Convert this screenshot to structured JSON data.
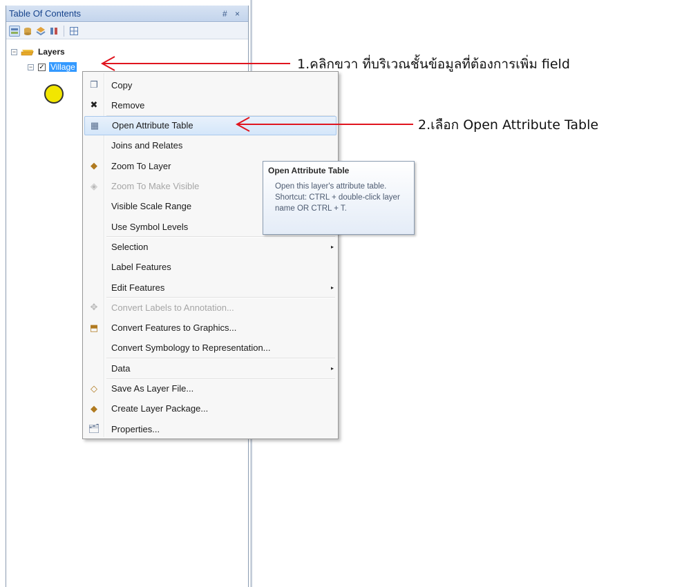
{
  "toc": {
    "title": "Table Of Contents",
    "title_controls": "# ×",
    "toolbar_icons": [
      "list-by-drawing-order-icon",
      "list-by-source-icon",
      "list-by-visibility-icon",
      "list-by-selection-icon",
      "options-icon"
    ],
    "tree": {
      "root_label": "Layers",
      "root_expander": "−",
      "layer_label": "Village",
      "layer_expander": "−",
      "layer_checked": "✓",
      "symbol_color": "#f2e600"
    }
  },
  "context_menu": {
    "items": [
      {
        "label": "Copy",
        "icon": "copy-icon",
        "glyph": "❐",
        "enabled": true
      },
      {
        "label": "Remove",
        "icon": "remove-icon",
        "glyph": "✖",
        "enabled": true
      },
      {
        "label": "Open Attribute Table",
        "icon": "table-icon",
        "glyph": "▦",
        "enabled": true,
        "highlighted": true
      },
      {
        "label": "Joins and Relates",
        "icon": "",
        "glyph": "",
        "enabled": true
      },
      {
        "label": "Zoom To Layer",
        "icon": "zoom-to-layer-icon",
        "glyph": "◆",
        "enabled": true
      },
      {
        "label": "Zoom To Make Visible",
        "icon": "zoom-to-make-visible-icon",
        "glyph": "◈",
        "enabled": false
      },
      {
        "label": "Visible Scale Range",
        "icon": "",
        "glyph": "",
        "enabled": true
      },
      {
        "label": "Use Symbol Levels",
        "icon": "",
        "glyph": "",
        "enabled": true
      },
      {
        "label": "Selection",
        "icon": "",
        "glyph": "",
        "enabled": true,
        "submenu": true
      },
      {
        "label": "Label Features",
        "icon": "",
        "glyph": "",
        "enabled": true
      },
      {
        "label": "Edit Features",
        "icon": "",
        "glyph": "",
        "enabled": true,
        "submenu": true
      },
      {
        "label": "Convert Labels to Annotation...",
        "icon": "convert-labels-icon",
        "glyph": "✥",
        "enabled": false
      },
      {
        "label": "Convert Features to Graphics...",
        "icon": "convert-features-icon",
        "glyph": "⬒",
        "enabled": true
      },
      {
        "label": "Convert Symbology to Representation...",
        "icon": "",
        "glyph": "",
        "enabled": true
      },
      {
        "label": "Data",
        "icon": "",
        "glyph": "",
        "enabled": true,
        "submenu": true
      },
      {
        "label": "Save As Layer File...",
        "icon": "save-layer-file-icon",
        "glyph": "◇",
        "enabled": true
      },
      {
        "label": "Create Layer Package...",
        "icon": "layer-package-icon",
        "glyph": "◆",
        "enabled": true
      },
      {
        "label": "Properties...",
        "icon": "properties-icon",
        "glyph": "🗂",
        "enabled": true
      }
    ],
    "submenu_arrow": "▸"
  },
  "tooltip": {
    "title": "Open Attribute Table",
    "body": "Open this layer's attribute table. Shortcut: CTRL + double-click layer name OR CTRL + T."
  },
  "annotations": {
    "step1": "1.คลิกขวา ที่บริเวณชั้นข้อมูลที่ต้องการเพิ่ม field",
    "step2": "2.เลือก Open Attribute Table",
    "arrow_color": "#e0141e"
  }
}
